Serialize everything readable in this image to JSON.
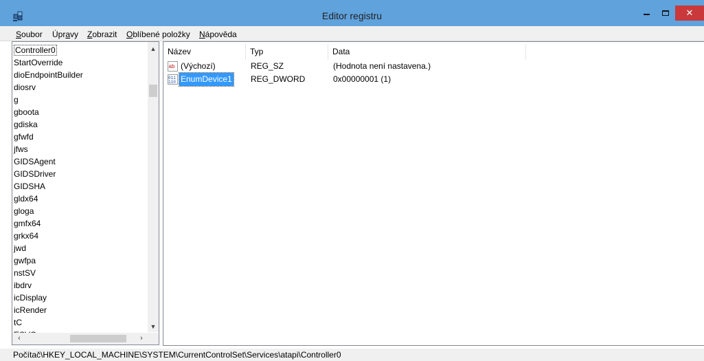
{
  "window": {
    "title": "Editor registru"
  },
  "menu": [
    {
      "label": "Soubor",
      "accel": "S",
      "rest": "oubor"
    },
    {
      "label": "Úpravy",
      "pre": "Úpr",
      "accel": "a",
      "rest": "vy"
    },
    {
      "label": "Zobrazit",
      "accel": "Z",
      "rest": "obrazit"
    },
    {
      "label": "Oblíbené položky",
      "accel": "O",
      "rest": "blíbené položky"
    },
    {
      "label": "Nápověda",
      "accel": "N",
      "rest": "ápověda"
    }
  ],
  "tree": {
    "items": [
      "Controller0",
      "StartOverride",
      "dioEndpointBuilder",
      "diosrv",
      "g",
      "gboota",
      "gdiska",
      "gfwfd",
      "jfws",
      "GIDSAgent",
      "GIDSDriver",
      "GIDSHA",
      "gldx64",
      "gloga",
      "gmfx64",
      "grkx64",
      "jwd",
      "gwfpa",
      "nstSV",
      "ibdrv",
      "icDisplay",
      "icRender",
      "tC",
      "ESVC"
    ],
    "selected_index": 0
  },
  "list": {
    "columns": [
      "Název",
      "Typ",
      "Data"
    ],
    "rows": [
      {
        "icon": "string-value-icon",
        "name": "(Výchozí)",
        "type": "REG_SZ",
        "data": "(Hodnota není nastavena.)"
      },
      {
        "icon": "binary-value-icon",
        "name": "EnumDevice1",
        "type": "REG_DWORD",
        "data": "0x00000001 (1)",
        "selected": true
      }
    ]
  },
  "status": {
    "path": "Počítač\\HKEY_LOCAL_MACHINE\\SYSTEM\\CurrentControlSet\\Services\\atapi\\Controller0"
  },
  "colors": {
    "titlebar": "#5fa2dc",
    "close": "#c9383a",
    "selection": "#3399ff"
  }
}
